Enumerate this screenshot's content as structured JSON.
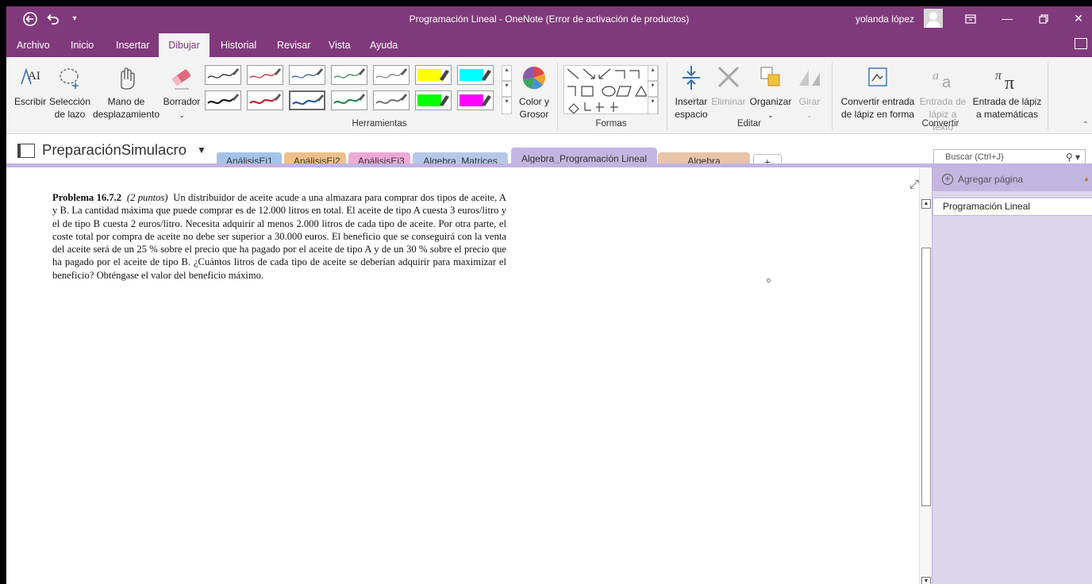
{
  "window": {
    "title": "Programación Lineal  -  OneNote (Error de activación de productos)",
    "user": "yolanda lópez"
  },
  "menu": {
    "tabs": [
      "Archivo",
      "Inicio",
      "Insertar",
      "Dibujar",
      "Historial",
      "Revisar",
      "Vista",
      "Ayuda"
    ],
    "active": "Dibujar"
  },
  "ribbon": {
    "tools": {
      "write": "Escribir",
      "lasso_l1": "Selección",
      "lasso_l2": "de lazo",
      "hand_l1": "Mano de",
      "hand_l2": "desplazamiento",
      "eraser": "Borrador",
      "color_l1": "Color y",
      "color_l2": "Grosor",
      "group": "Herramientas"
    },
    "shapes_group": "Formas",
    "edit": {
      "insert_l1": "Insertar",
      "insert_l2": "espacio",
      "delete": "Eliminar",
      "arrange": "Organizar",
      "rotate": "Girar",
      "group": "Editar"
    },
    "convert": {
      "ink_shape_l1": "Convertir entrada",
      "ink_shape_l2": "de lápiz en forma",
      "ink_text_l1": "Entrada de",
      "ink_text_l2": "lápiz a texto",
      "ink_math_l1": "Entrada de lápiz",
      "ink_math_l2": "a matemáticas",
      "group": "Convertir"
    },
    "pen_colors": [
      "#1a1a1a",
      "#c8202a",
      "#2a5aa8",
      "#2a8a4a",
      "#7a7a7a",
      "#ffff00",
      "#00ffff",
      "#1a1a1a",
      "#c8202a",
      "#2a5aa8",
      "#2a8a4a",
      "#7a7a7a",
      "#00ff00",
      "#ff00ff"
    ]
  },
  "notebook": {
    "name": "PreparaciónSimulacro",
    "sections": [
      {
        "label": "AnálisisEj1",
        "color": "#a3c4e8"
      },
      {
        "label": "AnálisisEj2",
        "color": "#f0c08c"
      },
      {
        "label": "AnálisisEj3",
        "color": "#eeaad6"
      },
      {
        "label": "Algebra_Matrices",
        "color": "#b6c8e8"
      },
      {
        "label": "Algebra_Programación Lineal",
        "color": "#c4b6e0"
      },
      {
        "label": "Algebra Sistemas",
        "color": "#e8c4a8"
      }
    ],
    "add_section": "+",
    "search_placeholder": "Buscar (Ctrl+J)"
  },
  "page": {
    "problem_label": "Problema 16.7.2",
    "points": "(2 puntos)",
    "problem_text": "Un distribuidor de aceite acude a una almazara para comprar dos tipos de aceite, A y B. La cantidad máxima que puede comprar es de 12.000 litros en total. El aceite de tipo A cuesta 3 euros/litro y el de tipo B cuesta 2 euros/litro. Necesita adquirir al menos 2.000 litros de cada tipo de aceite. Por otra parte, el coste total por compra de aceite no debe ser superior a 30.000 euros. El beneficio que se conseguirá con la venta del aceite será de un 25 % sobre el precio que ha pagado por el aceite de tipo A y de un 30 % sobre el precio que ha pagado por el aceite de tipo B. ¿Cuántos litros de cada tipo de aceite se deberían adquirir para maximizar el beneficio? Obténgase el valor del beneficio máximo."
  },
  "page_pane": {
    "add_page": "Agregar página",
    "pages": [
      "Programación Lineal"
    ]
  }
}
